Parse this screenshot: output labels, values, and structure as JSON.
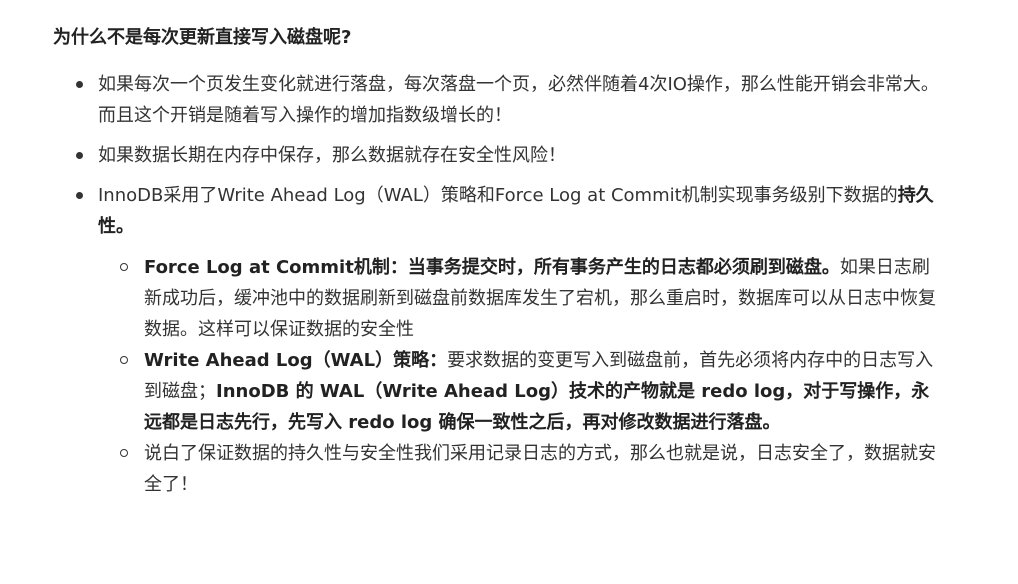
{
  "heading": "为什么不是每次更新直接写入磁盘呢?",
  "bullets": [
    {
      "text": "如果每次一个页发生变化就进行落盘，每次落盘一个页，必然伴随着4次IO操作，那么性能开销会非常大。而且这个开销是随着写入操作的增加指数级增长的！"
    },
    {
      "text": "如果数据长期在内存中保存，那么数据就存在安全性风险！"
    },
    {
      "text": "InnoDB采用了Write Ahead Log（WAL）策略和Force Log at Commit机制实现事务级别下数据的",
      "bold": "持久性。"
    }
  ],
  "sub_bullets": [
    {
      "bold": "Force Log at Commit机制：当事务提交时，所有事务产生的日志都必须刷到磁盘。",
      "text": "如果日志刷新成功后，缓冲池中的数据刷新到磁盘前数据库发生了宕机，那么重启时，数据库可以从日志中恢复数据。这样可以保证数据的安全性"
    },
    {
      "bold": "Write Ahead Log（WAL）策略：",
      "text": "要求数据的变更写入到磁盘前，首先必须将内存中的日志写入到磁盘；",
      "bold2": "InnoDB 的 WAL（Write Ahead Log）技术的产物就是 redo log，对于写操作，永远都是日志先行，先写入 redo log 确保一致性之后，再对修改数据进行落盘。"
    },
    {
      "text": "说白了保证数据的持久性与安全性我们采用记录日志的方式，那么也就是说，日志安全了，数据就安全了！"
    }
  ]
}
